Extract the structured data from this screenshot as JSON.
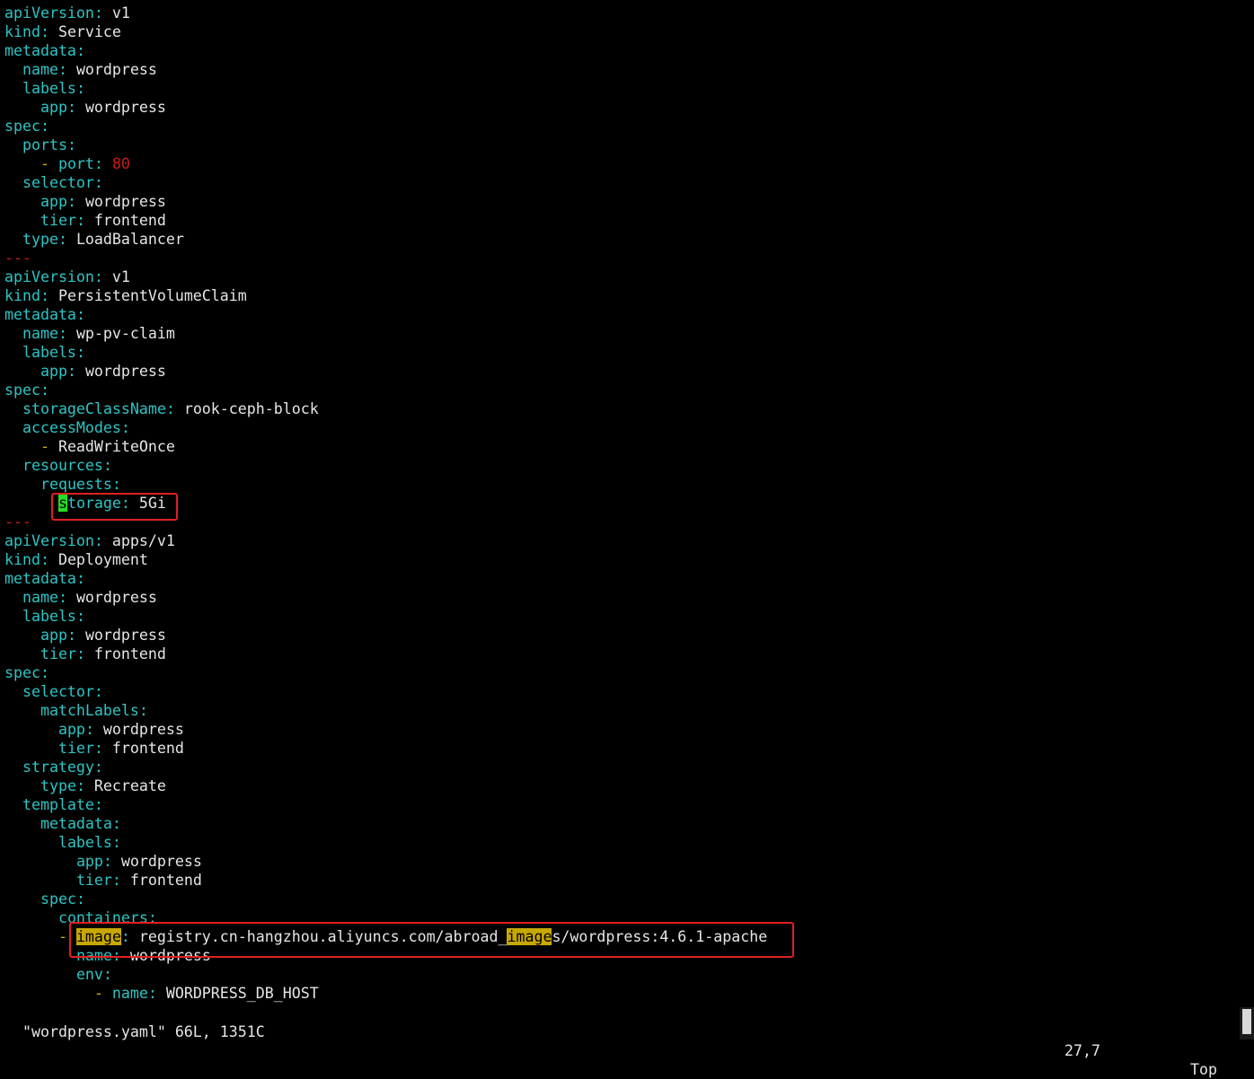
{
  "editor": {
    "lines": [
      {
        "indent": "",
        "segs": [
          {
            "t": "apiVersion",
            "c": "k"
          },
          {
            "t": ": ",
            "c": "p"
          },
          {
            "t": "v1",
            "c": "v"
          }
        ]
      },
      {
        "indent": "",
        "segs": [
          {
            "t": "kind",
            "c": "k"
          },
          {
            "t": ": ",
            "c": "p"
          },
          {
            "t": "Service",
            "c": "v"
          }
        ]
      },
      {
        "indent": "",
        "segs": [
          {
            "t": "metadata",
            "c": "k"
          },
          {
            "t": ":",
            "c": "p"
          }
        ]
      },
      {
        "indent": "  ",
        "segs": [
          {
            "t": "name",
            "c": "k"
          },
          {
            "t": ": ",
            "c": "p"
          },
          {
            "t": "wordpress",
            "c": "v"
          }
        ]
      },
      {
        "indent": "  ",
        "segs": [
          {
            "t": "labels",
            "c": "k"
          },
          {
            "t": ":",
            "c": "p"
          }
        ]
      },
      {
        "indent": "    ",
        "segs": [
          {
            "t": "app",
            "c": "k"
          },
          {
            "t": ": ",
            "c": "p"
          },
          {
            "t": "wordpress",
            "c": "v"
          }
        ]
      },
      {
        "indent": "",
        "segs": [
          {
            "t": "spec",
            "c": "k"
          },
          {
            "t": ":",
            "c": "p"
          }
        ]
      },
      {
        "indent": "  ",
        "segs": [
          {
            "t": "ports",
            "c": "k"
          },
          {
            "t": ":",
            "c": "p"
          }
        ]
      },
      {
        "indent": "    ",
        "segs": [
          {
            "t": "- ",
            "c": "d"
          },
          {
            "t": "port",
            "c": "k"
          },
          {
            "t": ": ",
            "c": "p"
          },
          {
            "t": "80",
            "c": "n"
          }
        ]
      },
      {
        "indent": "  ",
        "segs": [
          {
            "t": "selector",
            "c": "k"
          },
          {
            "t": ":",
            "c": "p"
          }
        ]
      },
      {
        "indent": "    ",
        "segs": [
          {
            "t": "app",
            "c": "k"
          },
          {
            "t": ": ",
            "c": "p"
          },
          {
            "t": "wordpress",
            "c": "v"
          }
        ]
      },
      {
        "indent": "    ",
        "segs": [
          {
            "t": "tier",
            "c": "k"
          },
          {
            "t": ": ",
            "c": "p"
          },
          {
            "t": "frontend",
            "c": "v"
          }
        ]
      },
      {
        "indent": "  ",
        "segs": [
          {
            "t": "type",
            "c": "k"
          },
          {
            "t": ": ",
            "c": "p"
          },
          {
            "t": "LoadBalancer",
            "c": "v"
          }
        ]
      },
      {
        "indent": "",
        "segs": [
          {
            "t": "---",
            "c": "sep"
          }
        ]
      },
      {
        "indent": "",
        "segs": [
          {
            "t": "apiVersion",
            "c": "k"
          },
          {
            "t": ": ",
            "c": "p"
          },
          {
            "t": "v1",
            "c": "v"
          }
        ]
      },
      {
        "indent": "",
        "segs": [
          {
            "t": "kind",
            "c": "k"
          },
          {
            "t": ": ",
            "c": "p"
          },
          {
            "t": "PersistentVolumeClaim",
            "c": "v"
          }
        ]
      },
      {
        "indent": "",
        "segs": [
          {
            "t": "metadata",
            "c": "k"
          },
          {
            "t": ":",
            "c": "p"
          }
        ]
      },
      {
        "indent": "  ",
        "segs": [
          {
            "t": "name",
            "c": "k"
          },
          {
            "t": ": ",
            "c": "p"
          },
          {
            "t": "wp-pv-claim",
            "c": "v"
          }
        ]
      },
      {
        "indent": "  ",
        "segs": [
          {
            "t": "labels",
            "c": "k"
          },
          {
            "t": ":",
            "c": "p"
          }
        ]
      },
      {
        "indent": "    ",
        "segs": [
          {
            "t": "app",
            "c": "k"
          },
          {
            "t": ": ",
            "c": "p"
          },
          {
            "t": "wordpress",
            "c": "v"
          }
        ]
      },
      {
        "indent": "",
        "segs": [
          {
            "t": "spec",
            "c": "k"
          },
          {
            "t": ":",
            "c": "p"
          }
        ]
      },
      {
        "indent": "  ",
        "segs": [
          {
            "t": "storageClassName",
            "c": "k"
          },
          {
            "t": ": ",
            "c": "p"
          },
          {
            "t": "rook-ceph-block",
            "c": "v"
          }
        ]
      },
      {
        "indent": "  ",
        "segs": [
          {
            "t": "accessModes",
            "c": "k"
          },
          {
            "t": ":",
            "c": "p"
          }
        ]
      },
      {
        "indent": "    ",
        "segs": [
          {
            "t": "- ",
            "c": "d"
          },
          {
            "t": "ReadWriteOnce",
            "c": "v"
          }
        ]
      },
      {
        "indent": "  ",
        "segs": [
          {
            "t": "resources",
            "c": "k"
          },
          {
            "t": ":",
            "c": "p"
          }
        ]
      },
      {
        "indent": "    ",
        "segs": [
          {
            "t": "requests",
            "c": "k"
          },
          {
            "t": ":",
            "c": "p"
          }
        ]
      },
      {
        "indent": "      ",
        "segs": [
          {
            "t": "s",
            "c": "cur"
          },
          {
            "t": "torage",
            "c": "k"
          },
          {
            "t": ": ",
            "c": "p"
          },
          {
            "t": "5Gi",
            "c": "v"
          }
        ]
      },
      {
        "indent": "",
        "segs": [
          {
            "t": "---",
            "c": "sep"
          }
        ]
      },
      {
        "indent": "",
        "segs": [
          {
            "t": "apiVersion",
            "c": "k"
          },
          {
            "t": ": ",
            "c": "p"
          },
          {
            "t": "apps/v1",
            "c": "v"
          }
        ]
      },
      {
        "indent": "",
        "segs": [
          {
            "t": "kind",
            "c": "k"
          },
          {
            "t": ": ",
            "c": "p"
          },
          {
            "t": "Deployment",
            "c": "v"
          }
        ]
      },
      {
        "indent": "",
        "segs": [
          {
            "t": "metadata",
            "c": "k"
          },
          {
            "t": ":",
            "c": "p"
          }
        ]
      },
      {
        "indent": "  ",
        "segs": [
          {
            "t": "name",
            "c": "k"
          },
          {
            "t": ": ",
            "c": "p"
          },
          {
            "t": "wordpress",
            "c": "v"
          }
        ]
      },
      {
        "indent": "  ",
        "segs": [
          {
            "t": "labels",
            "c": "k"
          },
          {
            "t": ":",
            "c": "p"
          }
        ]
      },
      {
        "indent": "    ",
        "segs": [
          {
            "t": "app",
            "c": "k"
          },
          {
            "t": ": ",
            "c": "p"
          },
          {
            "t": "wordpress",
            "c": "v"
          }
        ]
      },
      {
        "indent": "    ",
        "segs": [
          {
            "t": "tier",
            "c": "k"
          },
          {
            "t": ": ",
            "c": "p"
          },
          {
            "t": "frontend",
            "c": "v"
          }
        ]
      },
      {
        "indent": "",
        "segs": [
          {
            "t": "spec",
            "c": "k"
          },
          {
            "t": ":",
            "c": "p"
          }
        ]
      },
      {
        "indent": "  ",
        "segs": [
          {
            "t": "selector",
            "c": "k"
          },
          {
            "t": ":",
            "c": "p"
          }
        ]
      },
      {
        "indent": "    ",
        "segs": [
          {
            "t": "matchLabels",
            "c": "k"
          },
          {
            "t": ":",
            "c": "p"
          }
        ]
      },
      {
        "indent": "      ",
        "segs": [
          {
            "t": "app",
            "c": "k"
          },
          {
            "t": ": ",
            "c": "p"
          },
          {
            "t": "wordpress",
            "c": "v"
          }
        ]
      },
      {
        "indent": "      ",
        "segs": [
          {
            "t": "tier",
            "c": "k"
          },
          {
            "t": ": ",
            "c": "p"
          },
          {
            "t": "frontend",
            "c": "v"
          }
        ]
      },
      {
        "indent": "  ",
        "segs": [
          {
            "t": "strategy",
            "c": "k"
          },
          {
            "t": ":",
            "c": "p"
          }
        ]
      },
      {
        "indent": "    ",
        "segs": [
          {
            "t": "type",
            "c": "k"
          },
          {
            "t": ": ",
            "c": "p"
          },
          {
            "t": "Recreate",
            "c": "v"
          }
        ]
      },
      {
        "indent": "  ",
        "segs": [
          {
            "t": "template",
            "c": "k"
          },
          {
            "t": ":",
            "c": "p"
          }
        ]
      },
      {
        "indent": "    ",
        "segs": [
          {
            "t": "metadata",
            "c": "k"
          },
          {
            "t": ":",
            "c": "p"
          }
        ]
      },
      {
        "indent": "      ",
        "segs": [
          {
            "t": "labels",
            "c": "k"
          },
          {
            "t": ":",
            "c": "p"
          }
        ]
      },
      {
        "indent": "        ",
        "segs": [
          {
            "t": "app",
            "c": "k"
          },
          {
            "t": ": ",
            "c": "p"
          },
          {
            "t": "wordpress",
            "c": "v"
          }
        ]
      },
      {
        "indent": "        ",
        "segs": [
          {
            "t": "tier",
            "c": "k"
          },
          {
            "t": ": ",
            "c": "p"
          },
          {
            "t": "frontend",
            "c": "v"
          }
        ]
      },
      {
        "indent": "    ",
        "segs": [
          {
            "t": "spec",
            "c": "k"
          },
          {
            "t": ":",
            "c": "p"
          }
        ]
      },
      {
        "indent": "      ",
        "segs": [
          {
            "t": "containers",
            "c": "k"
          },
          {
            "t": ":",
            "c": "p"
          }
        ]
      },
      {
        "indent": "      ",
        "segs": [
          {
            "t": "- ",
            "c": "d"
          },
          {
            "t": "image",
            "c": "hl"
          },
          {
            "t": ": ",
            "c": "p"
          },
          {
            "t": "registry.cn-hangzhou.aliyuncs.com/abroad_",
            "c": "v"
          },
          {
            "t": "image",
            "c": "hl"
          },
          {
            "t": "s/wordpress:4.6.1-apache",
            "c": "v"
          }
        ]
      },
      {
        "indent": "        ",
        "segs": [
          {
            "t": "name",
            "c": "k"
          },
          {
            "t": ": ",
            "c": "p"
          },
          {
            "t": "wordpress",
            "c": "v"
          }
        ]
      },
      {
        "indent": "        ",
        "segs": [
          {
            "t": "env",
            "c": "k"
          },
          {
            "t": ":",
            "c": "p"
          }
        ]
      },
      {
        "indent": "          ",
        "segs": [
          {
            "t": "- ",
            "c": "d"
          },
          {
            "t": "name",
            "c": "k"
          },
          {
            "t": ": ",
            "c": "p"
          },
          {
            "t": "WORDPRESS_DB_HOST",
            "c": "v"
          }
        ]
      }
    ]
  },
  "status": {
    "file_info": "\"wordpress.yaml\" 66L, 1351C",
    "cursor_pos": "27,7",
    "scroll_pos": "Top"
  },
  "colors": {
    "background": "#000000",
    "key": "#2ec4c4",
    "value": "#e6e6e6",
    "number": "#d01818",
    "search_highlight": "#c8a800",
    "cursor": "#22e022",
    "annotation_box": "#e02020"
  }
}
